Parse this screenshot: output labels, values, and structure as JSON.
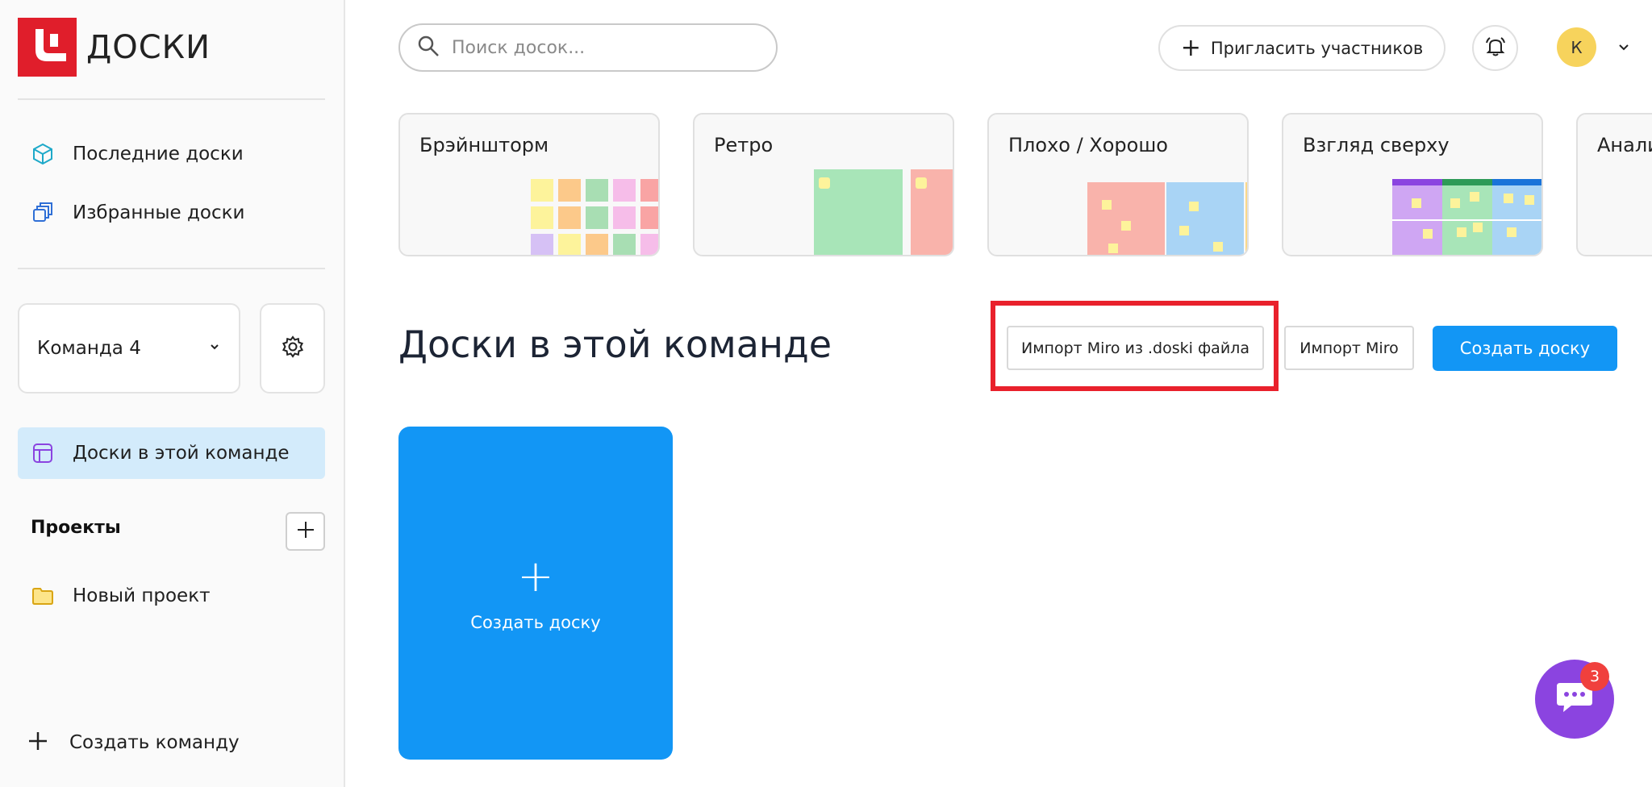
{
  "app": {
    "logo_text": "ДОСКИ",
    "brand_color": "#e01e2b",
    "accent_color": "#1296f5"
  },
  "sidebar": {
    "nav": [
      {
        "label": "Последние доски",
        "icon": "cube-icon"
      },
      {
        "label": "Избранные доски",
        "icon": "stack-icon"
      }
    ],
    "team_select": {
      "value": "Команда 4"
    },
    "active_item": {
      "label": "Доски в этой команде",
      "icon": "board-icon"
    },
    "projects": {
      "title": "Проекты",
      "items": [
        {
          "label": "Новый проект",
          "icon": "folder-icon"
        }
      ]
    },
    "create_team_label": "Создать команду"
  },
  "header": {
    "search_placeholder": "Поиск досок...",
    "invite_label": "Пригласить участников",
    "avatar_letter": "К"
  },
  "templates": [
    {
      "name": "Брэйншторм"
    },
    {
      "name": "Ретро"
    },
    {
      "name": "Плохо / Хорошо"
    },
    {
      "name": "Взгляд сверху"
    },
    {
      "name": "Анали"
    }
  ],
  "main": {
    "section_title": "Доски в этой команде",
    "import_doski_label": "Импорт Miro из .doski файла",
    "import_miro_label": "Импорт Miro",
    "create_board_label": "Создать доску",
    "create_card_label": "Создать доску"
  },
  "chat": {
    "badge_count": "3"
  }
}
